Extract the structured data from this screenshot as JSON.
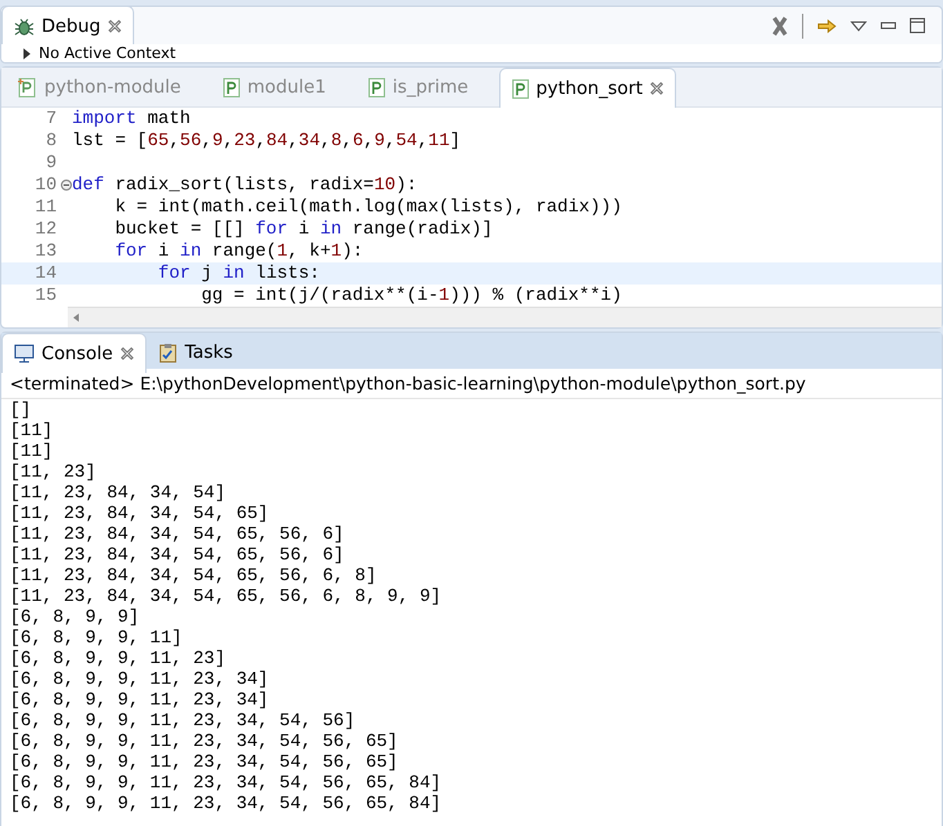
{
  "debug_view": {
    "tab": {
      "label": "Debug",
      "closable": true
    },
    "context_label": "No Active Context"
  },
  "editor": {
    "tabs": [
      {
        "label": "python-module",
        "selected": false,
        "kind": "project"
      },
      {
        "label": "module1",
        "selected": false,
        "kind": "module"
      },
      {
        "label": "is_prime",
        "selected": false,
        "kind": "module"
      },
      {
        "label": "python_sort",
        "selected": true,
        "kind": "module"
      }
    ],
    "lines": [
      {
        "number": "7",
        "current": false,
        "folding": false,
        "tokens": [
          {
            "text": "import",
            "kind": "keyword"
          },
          {
            "text": " math",
            "kind": "plain"
          }
        ]
      },
      {
        "number": "8",
        "current": false,
        "folding": false,
        "tokens": [
          {
            "text": "lst = [",
            "kind": "plain"
          },
          {
            "text": "65",
            "kind": "number"
          },
          {
            "text": ",",
            "kind": "plain"
          },
          {
            "text": "56",
            "kind": "number"
          },
          {
            "text": ",",
            "kind": "plain"
          },
          {
            "text": "9",
            "kind": "number"
          },
          {
            "text": ",",
            "kind": "plain"
          },
          {
            "text": "23",
            "kind": "number"
          },
          {
            "text": ",",
            "kind": "plain"
          },
          {
            "text": "84",
            "kind": "number"
          },
          {
            "text": ",",
            "kind": "plain"
          },
          {
            "text": "34",
            "kind": "number"
          },
          {
            "text": ",",
            "kind": "plain"
          },
          {
            "text": "8",
            "kind": "number"
          },
          {
            "text": ",",
            "kind": "plain"
          },
          {
            "text": "6",
            "kind": "number"
          },
          {
            "text": ",",
            "kind": "plain"
          },
          {
            "text": "9",
            "kind": "number"
          },
          {
            "text": ",",
            "kind": "plain"
          },
          {
            "text": "54",
            "kind": "number"
          },
          {
            "text": ",",
            "kind": "plain"
          },
          {
            "text": "11",
            "kind": "number"
          },
          {
            "text": "]",
            "kind": "plain"
          }
        ]
      },
      {
        "number": "9",
        "current": false,
        "folding": false
      },
      {
        "number": "10",
        "current": false,
        "folding": true,
        "tokens": [
          {
            "text": "def",
            "kind": "keyword"
          },
          {
            "text": " radix_sort(lists, radix=",
            "kind": "plain"
          },
          {
            "text": "10",
            "kind": "number"
          },
          {
            "text": "):",
            "kind": "plain"
          }
        ]
      },
      {
        "number": "11",
        "current": false,
        "folding": false,
        "tokens": [
          {
            "text": "    k = int(math.ceil(math.log(max(lists), radix)))",
            "kind": "plain"
          }
        ]
      },
      {
        "number": "12",
        "current": false,
        "folding": false,
        "tokens": [
          {
            "text": "    bucket = [[] ",
            "kind": "plain"
          },
          {
            "text": "for",
            "kind": "keyword"
          },
          {
            "text": " i ",
            "kind": "plain"
          },
          {
            "text": "in",
            "kind": "keyword"
          },
          {
            "text": " range(radix)]",
            "kind": "plain"
          }
        ]
      },
      {
        "number": "13",
        "current": false,
        "folding": false,
        "tokens": [
          {
            "text": "    for",
            "kind": "keyword"
          },
          {
            "text": " i ",
            "kind": "plain"
          },
          {
            "text": "in",
            "kind": "keyword"
          },
          {
            "text": " range(",
            "kind": "plain"
          },
          {
            "text": "1",
            "kind": "number"
          },
          {
            "text": ", k+",
            "kind": "plain"
          },
          {
            "text": "1",
            "kind": "number"
          },
          {
            "text": "):",
            "kind": "plain"
          }
        ]
      },
      {
        "number": "14",
        "current": true,
        "folding": false,
        "tokens": [
          {
            "text": "        for",
            "kind": "keyword"
          },
          {
            "text": " j ",
            "kind": "plain"
          },
          {
            "text": "in",
            "kind": "keyword"
          },
          {
            "text": " lists:",
            "kind": "plain"
          }
        ]
      },
      {
        "number": "15",
        "current": false,
        "folding": false,
        "tokens": [
          {
            "text": "            gg = int(j/(radix**(i-",
            "kind": "plain"
          },
          {
            "text": "1",
            "kind": "number"
          },
          {
            "text": "))) % (radix**i)",
            "kind": "plain"
          }
        ]
      }
    ]
  },
  "bottom_panel": {
    "tabs": [
      {
        "label": "Console",
        "selected": true,
        "closable": true,
        "kind": "console"
      },
      {
        "label": "Tasks",
        "selected": false,
        "closable": false,
        "kind": "tasks"
      }
    ],
    "process_label": "<terminated> E:\\pythonDevelopment\\python-basic-learning\\python-module\\python_sort.py",
    "output_lines": [
      "[]",
      "[11]",
      "[11]",
      "[11, 23]",
      "[11, 23, 84, 34, 54]",
      "[11, 23, 84, 34, 54, 65]",
      "[11, 23, 84, 34, 54, 65, 56, 6]",
      "[11, 23, 84, 34, 54, 65, 56, 6]",
      "[11, 23, 84, 34, 54, 65, 56, 6, 8]",
      "[11, 23, 84, 34, 54, 65, 56, 6, 8, 9, 9]",
      "[6, 8, 9, 9]",
      "[6, 8, 9, 9, 11]",
      "[6, 8, 9, 9, 11, 23]",
      "[6, 8, 9, 9, 11, 23, 34]",
      "[6, 8, 9, 9, 11, 23, 34]",
      "[6, 8, 9, 9, 11, 23, 34, 54, 56]",
      "[6, 8, 9, 9, 11, 23, 34, 54, 56, 65]",
      "[6, 8, 9, 9, 11, 23, 34, 54, 56, 65]",
      "[6, 8, 9, 9, 11, 23, 34, 54, 56, 65, 84]",
      "[6, 8, 9, 9, 11, 23, 34, 54, 56, 65, 84]"
    ]
  }
}
